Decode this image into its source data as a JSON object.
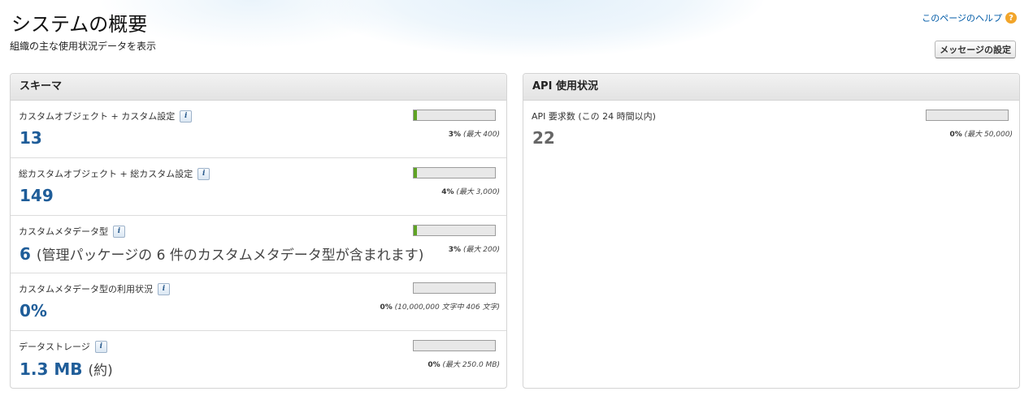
{
  "header": {
    "title": "システムの概要",
    "subtitle": "組織の主な使用状況データを表示",
    "help_link": "このページのヘルプ",
    "message_button": "メッセージの設定"
  },
  "schema_panel": {
    "title": "スキーマ",
    "rows": [
      {
        "label": "カスタムオブジェクト + カスタム設定",
        "value": "13",
        "value_suffix": "",
        "percent": 3,
        "percent_text": "3%",
        "limit_text": "(最大 400)"
      },
      {
        "label": "総カスタムオブジェクト + 総カスタム設定",
        "value": "149",
        "value_suffix": "",
        "percent": 4,
        "percent_text": "4%",
        "limit_text": "(最大 3,000)"
      },
      {
        "label": "カスタムメタデータ型",
        "value": "6",
        "value_suffix": "(管理パッケージの 6 件のカスタムメタデータ型が含まれます)",
        "percent": 3,
        "percent_text": "3%",
        "limit_text": "(最大 200)"
      },
      {
        "label": "カスタムメタデータ型の利用状況",
        "value": "0%",
        "value_suffix": "",
        "percent": 0,
        "percent_text": "0%",
        "limit_text": "(10,000,000 文字中 406 文字)"
      },
      {
        "label": "データストレージ",
        "value": "1.3 MB",
        "value_suffix": "(約)",
        "percent": 0,
        "percent_text": "0%",
        "limit_text": "(最大 250.0 MB)"
      }
    ]
  },
  "api_panel": {
    "title": "API 使用状況",
    "rows": [
      {
        "label": "API 要求数 (この 24 時間以内)",
        "value": "22",
        "value_suffix": "",
        "percent": 0,
        "percent_text": "0%",
        "limit_text": "(最大 50,000)"
      }
    ]
  },
  "icons": {
    "info": "i",
    "help": "?"
  },
  "colors": {
    "value_blue": "#1f5d99",
    "value_grey": "#666666",
    "bar_fill": "#5fa324",
    "link": "#015ba7",
    "help_icon": "#f2a52a"
  }
}
